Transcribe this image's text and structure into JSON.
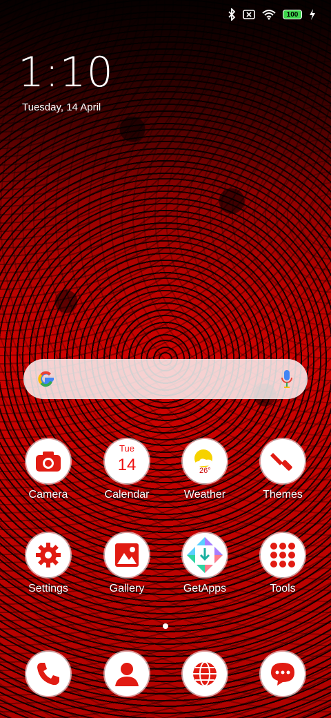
{
  "status": {
    "battery": "100",
    "icons": [
      "bluetooth-icon",
      "no-sim-icon",
      "wifi-icon",
      "battery-icon",
      "charging-icon"
    ]
  },
  "clock": {
    "time": "1:10",
    "date": "Tuesday, 14 April"
  },
  "search": {
    "logo": "google-logo",
    "mic": "mic-icon"
  },
  "apps": {
    "row1": [
      {
        "label": "Camera"
      },
      {
        "label": "Calendar",
        "day": "Tue",
        "date": "14"
      },
      {
        "label": "Weather",
        "temp": "26°"
      },
      {
        "label": "Themes"
      }
    ],
    "row2": [
      {
        "label": "Settings"
      },
      {
        "label": "Gallery"
      },
      {
        "label": "GetApps"
      },
      {
        "label": "Tools"
      }
    ]
  },
  "dock": [
    "phone-icon",
    "contacts-icon",
    "browser-icon",
    "messages-icon"
  ],
  "colors": {
    "accent": "#e11b12",
    "battery": "#3cd44b"
  }
}
